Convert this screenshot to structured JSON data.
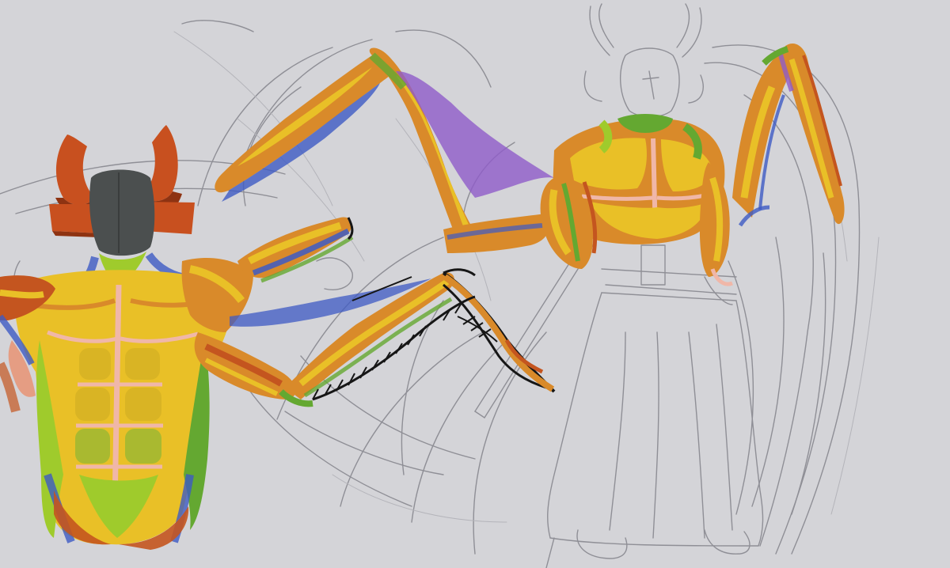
{
  "canvas": {
    "background": "#d4d4d8"
  },
  "palette": {
    "sketch_line": "#8f8f96",
    "sketch_light": "#b4b4ba",
    "ink": "#161616",
    "helmet": "#4b4f4f",
    "horn": "#c8501f",
    "horn_dark": "#8e3312",
    "muscle_yellow": "#e9c027",
    "muscle_orange": "#d98a2a",
    "muscle_red": "#c4551f",
    "tendon_pink": "#f0b7a8",
    "tendon_green": "#64a831",
    "lime": "#9fcb2c",
    "shadow_blue": "#3d5ac4",
    "violet": "#8e5bc9"
  },
  "figures": [
    {
      "name": "horned-demon-torso",
      "style": "painted muscle study",
      "horns": 2
    },
    {
      "name": "armored-warrior",
      "style": "painted upper body over pencil sketch",
      "horns": 2
    },
    {
      "name": "wing-sketch",
      "style": "loose pencil lines",
      "horns": 0
    }
  ]
}
